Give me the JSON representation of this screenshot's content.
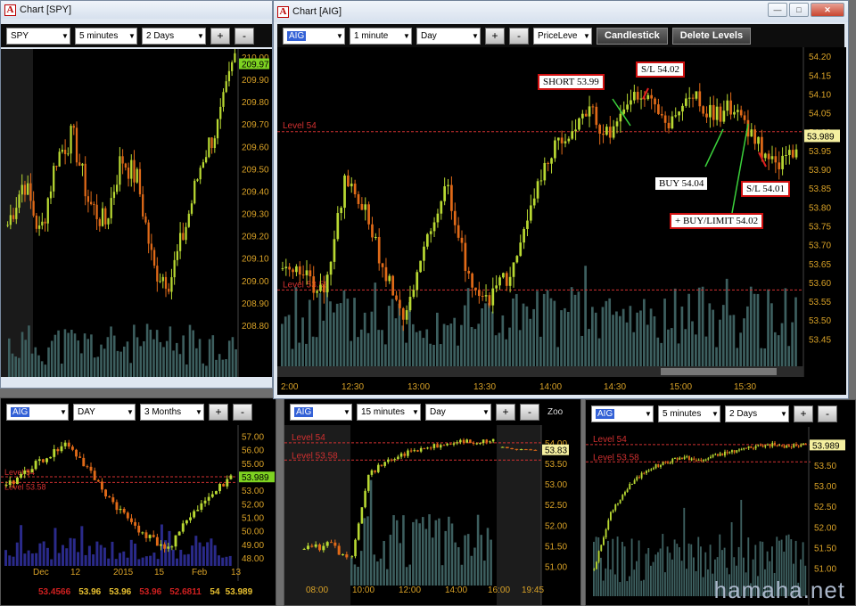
{
  "windows": {
    "spy": {
      "title": "Chart [SPY]",
      "symbol": "SPY",
      "interval": "5 minutes",
      "range": "2 Days",
      "plus": "+",
      "minus": "-",
      "price_tag": "209.97",
      "y_ticks": [
        "210.00",
        "209.90",
        "209.80",
        "209.70",
        "209.60",
        "209.50",
        "209.40",
        "209.30",
        "209.20",
        "209.10",
        "209.00",
        "208.90",
        "208.80"
      ]
    },
    "aig_main": {
      "title": "Chart [AIG]",
      "symbol": "AIG",
      "interval": "1 minute",
      "range": "Day",
      "plus": "+",
      "minus": "-",
      "study": "PriceLeve",
      "candlestick_label": "Candlestick",
      "delete_levels_label": "Delete Levels",
      "level_label": "Level 54",
      "level2_label": "Level 53.58",
      "price_tag": "53.989",
      "y_ticks": [
        "54.20",
        "54.15",
        "54.10",
        "54.05",
        "54.00",
        "53.95",
        "53.90",
        "53.85",
        "53.80",
        "53.75",
        "53.70",
        "53.65",
        "53.60",
        "53.55",
        "53.50",
        "53.45"
      ],
      "x_ticks": [
        "2:00",
        "12:30",
        "13:00",
        "13:30",
        "14:00",
        "14:30",
        "15:00",
        "15:30"
      ],
      "callouts": {
        "short": "SHORT 53.99",
        "sl1": "S/L 54.02",
        "buy": "BUY 54.04",
        "sl2": "S/L 54.01",
        "buylimit": "+ BUY/LIMIT 54.02"
      }
    },
    "aig_daily": {
      "symbol": "AIG",
      "interval": "DAY",
      "range": "3 Months",
      "plus": "+",
      "minus": "-",
      "level_label": "Level 54",
      "level2_label": "Level 53.58",
      "price_tag": "53.989",
      "y_ticks": [
        "57.00",
        "56.00",
        "55.00",
        "54.00",
        "53.00",
        "52.00",
        "51.00",
        "50.00",
        "49.00",
        "48.00"
      ],
      "x_ticks": [
        "Dec",
        "12",
        "2015",
        "15",
        "Feb",
        "13"
      ],
      "bottom_values": [
        {
          "text": "53.4566",
          "color": "#d02020"
        },
        {
          "text": "53.96",
          "color": "#e8c030"
        },
        {
          "text": "53.96",
          "color": "#e8c030"
        },
        {
          "text": "53.96",
          "color": "#d02020"
        },
        {
          "text": "52.6811",
          "color": "#d02020"
        },
        {
          "text": "54",
          "color": "#e8c030"
        },
        {
          "text": "53.989",
          "color": "#e8c030"
        }
      ]
    },
    "aig_15": {
      "symbol": "AIG",
      "interval": "15 minutes",
      "range": "Day",
      "plus": "+",
      "minus": "-",
      "zoom": "Zoo",
      "level_label": "Level 54",
      "level2_label": "Level 53.58",
      "price_tag": "53.83",
      "y_ticks": [
        "54.00",
        "53.50",
        "53.00",
        "52.50",
        "52.00",
        "51.50",
        "51.00"
      ],
      "x_ticks": [
        "08:00",
        "10:00",
        "12:00",
        "14:00",
        "16:00",
        "19:45"
      ]
    },
    "aig_5": {
      "symbol": "AIG",
      "interval": "5 minutes",
      "range": "2 Days",
      "plus": "+",
      "minus": "-",
      "level_label": "Level 54",
      "level2_label": "Level 53.58",
      "price_tag": "53.989",
      "y_ticks": [
        "54.00",
        "53.50",
        "53.00",
        "52.50",
        "52.00",
        "51.50",
        "51.00"
      ]
    }
  },
  "watermark": "hamaha.net",
  "colors": {
    "up": "#b8d832",
    "down": "#e06a18",
    "volume": "#3d5f5f",
    "level": "#d03030",
    "axis": "#d9a227"
  },
  "icons": {
    "app": "app-logo-icon",
    "minimize": "minimize-icon",
    "maximize": "maximize-icon",
    "close": "close-icon",
    "dropdown": "chevron-down-icon"
  },
  "glyphs": {
    "app": "A",
    "minimize": "—",
    "maximize": "□",
    "close": "✕",
    "dropdown": "▼"
  }
}
